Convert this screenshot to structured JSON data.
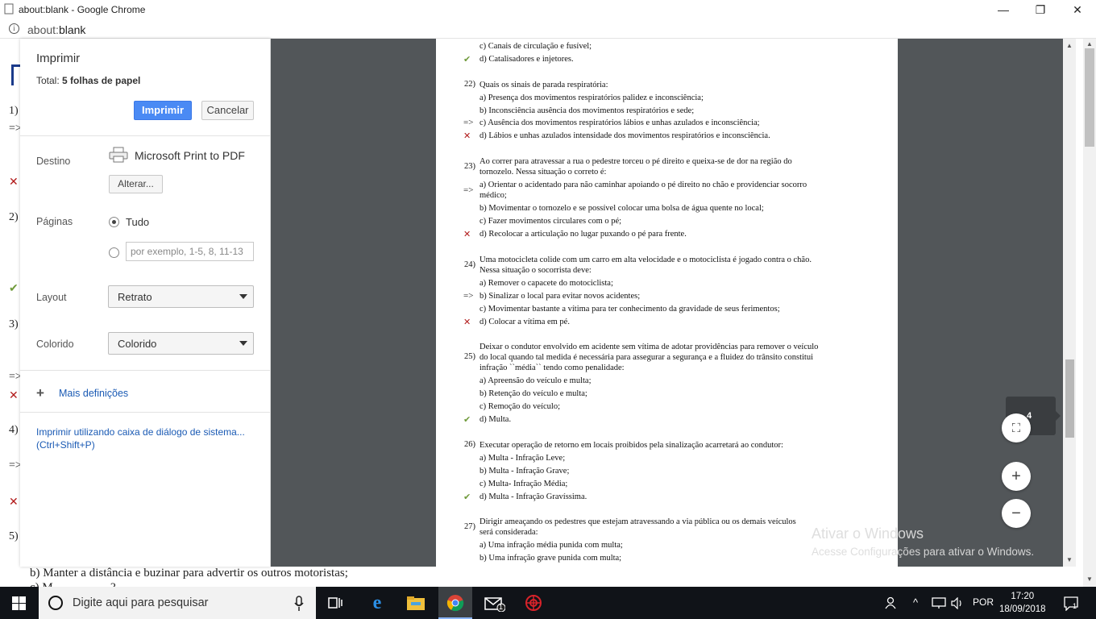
{
  "window": {
    "title": "about:blank - Google Chrome",
    "minimize_glyph": "—",
    "restore_glyph": "❐",
    "close_glyph": "✕"
  },
  "address": {
    "info_glyph": "i",
    "scheme": "about:",
    "path": "blank"
  },
  "background_page": {
    "items": [
      "1)",
      "=>",
      "2)",
      "3)",
      "=>",
      "4)",
      "=>",
      "5)"
    ],
    "line_b": "b) Manter a distância e buzinar para advertir os outros motoristas;",
    "line_c": "c) M... ... ... ... ...?"
  },
  "print_panel": {
    "title": "Imprimir",
    "total_label": "Total:",
    "total_value": "5 folhas de papel",
    "print_button": "Imprimir",
    "cancel_button": "Cancelar",
    "destination_label": "Destino",
    "destination_name": "Microsoft Print to PDF",
    "change_button": "Alterar...",
    "pages_label": "Páginas",
    "pages_all": "Tudo",
    "pages_placeholder": "por exemplo, 1-5, 8, 11-13",
    "layout_label": "Layout",
    "layout_value": "Retrato",
    "color_label": "Colorido",
    "color_value": "Colorido",
    "more_settings": "Mais definições",
    "more_plus": "+",
    "system_dialog_line1": "Imprimir utilizando caixa de diálogo de sistema...",
    "system_dialog_line2": "(Ctrl+Shift+P)"
  },
  "preview": {
    "lines": [
      {
        "text": "c) Canais de circulação e fusível;",
        "mark": ""
      },
      {
        "text": "d) Catalisadores e injetores.",
        "mark": "✔"
      },
      {
        "text": "Quais os sinais de parada respiratória:",
        "num": "22)"
      },
      {
        "text": "a) Presença dos movimentos respiratórios palidez e inconsciência;",
        "mark": ""
      },
      {
        "text": "b) Inconsciência ausência dos movimentos respiratórios e sede;",
        "mark": ""
      },
      {
        "text": "c) Ausência dos movimentos respiratórios lábios e unhas azulados e inconsciência;",
        "mark": "=>"
      },
      {
        "text": "d) Lábios e unhas azulados intensidade dos movimentos respiratórios e inconsciência.",
        "mark": "✕"
      },
      {
        "text": "Ao correr para atravessar a rua o pedestre torceu o pé direito e queixa-se de dor na região do tornozelo. Nessa situação o correto é:",
        "num": "23)"
      },
      {
        "text": "a) Orientar o acidentado para não caminhar apoiando o pé direito no chão e providenciar socorro médico;",
        "mark": "=>"
      },
      {
        "text": "b) Movimentar o tornozelo e se possível colocar uma bolsa de água quente no local;",
        "mark": ""
      },
      {
        "text": "c) Fazer movimentos circulares com o pé;",
        "mark": ""
      },
      {
        "text": "d) Recolocar a articulação no lugar puxando o pé para frente.",
        "mark": "✕"
      },
      {
        "text": "Uma motocicleta colide com um carro em alta velocidade e o motociclista é jogado contra o chão. Nessa situação o socorrista deve:",
        "num": "24)"
      },
      {
        "text": "a) Remover o capacete do motociclista;",
        "mark": ""
      },
      {
        "text": "b) Sinalizar o local para evitar novos acidentes;",
        "mark": "=>"
      },
      {
        "text": "c) Movimentar bastante a vítima para ter conhecimento da gravidade de seus ferimentos;",
        "mark": ""
      },
      {
        "text": "d) Colocar a vítima em pé.",
        "mark": "✕"
      },
      {
        "text": "Deixar o condutor envolvido em acidente sem vítima de adotar providências para remover o veículo do local quando tal medida é necessária para assegurar a segurança e a fluidez do trânsito constitui infração ``média`` tendo como penalidade:",
        "num": "25)"
      },
      {
        "text": "a) Apreensão do veículo e multa;",
        "mark": ""
      },
      {
        "text": "b) Retenção do veículo e multa;",
        "mark": ""
      },
      {
        "text": "c) Remoção do veículo;",
        "mark": ""
      },
      {
        "text": "d) Multa.",
        "mark": "✔"
      },
      {
        "text": "Executar operação de retorno em locais proibidos pela sinalização acarretará ao condutor:",
        "num": "26)"
      },
      {
        "text": "a) Multa - Infração Leve;",
        "mark": ""
      },
      {
        "text": "b) Multa - Infração Grave;",
        "mark": ""
      },
      {
        "text": "c) Multa- Infração Média;",
        "mark": ""
      },
      {
        "text": "d) Multa - Infração Gravíssima.",
        "mark": "✔"
      },
      {
        "text": "Dirigir ameaçando os pedestres que estejam atravessando a via pública ou os demais veículos será considerada:",
        "num": "27)"
      },
      {
        "text": "a) Uma infração média punida com multa;",
        "mark": ""
      },
      {
        "text": "b) Uma infração grave punida com multa;",
        "mark": ""
      }
    ],
    "page_number": "4",
    "fit_glyph": "⛶",
    "zoom_in": "+",
    "zoom_out": "−",
    "scroll_up": "▲",
    "scroll_down": "▼"
  },
  "watermark": {
    "line1": "Ativar o Windows",
    "line2": "Acesse Configurações para ativar o Windows."
  },
  "taskbar": {
    "search_placeholder": "Digite aqui para pesquisar",
    "language": "POR",
    "time": "17:20",
    "date": "18/09/2018",
    "mail_badge": "1",
    "notification_badge": "1"
  }
}
